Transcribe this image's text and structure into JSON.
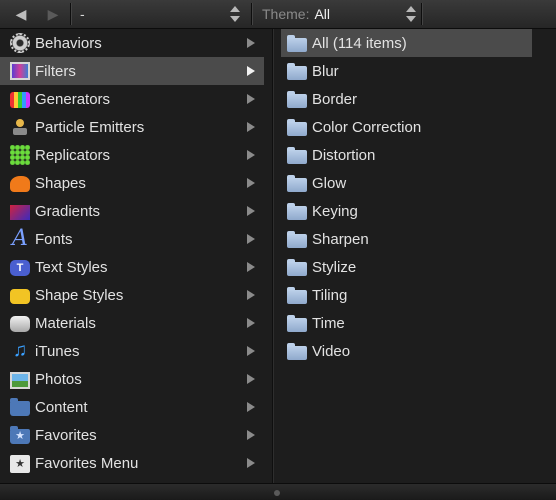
{
  "toolbar": {
    "back_icon": "back-arrow-icon",
    "forward_icon": "forward-arrow-icon",
    "path_value": "-",
    "theme_label": "Theme:",
    "theme_value": "All"
  },
  "categories": [
    {
      "label": "Behaviors",
      "icon": "gear-icon"
    },
    {
      "label": "Filters",
      "icon": "filters-icon",
      "selected": true
    },
    {
      "label": "Generators",
      "icon": "generators-icon"
    },
    {
      "label": "Particle Emitters",
      "icon": "particle-emitters-icon"
    },
    {
      "label": "Replicators",
      "icon": "replicators-icon"
    },
    {
      "label": "Shapes",
      "icon": "shapes-icon"
    },
    {
      "label": "Gradients",
      "icon": "gradients-icon"
    },
    {
      "label": "Fonts",
      "icon": "fonts-icon"
    },
    {
      "label": "Text Styles",
      "icon": "text-styles-icon"
    },
    {
      "label": "Shape Styles",
      "icon": "shape-styles-icon"
    },
    {
      "label": "Materials",
      "icon": "materials-icon"
    },
    {
      "label": "iTunes",
      "icon": "music-note-icon"
    },
    {
      "label": "Photos",
      "icon": "photos-icon"
    },
    {
      "label": "Content",
      "icon": "folder-icon"
    },
    {
      "label": "Favorites",
      "icon": "favorites-folder-icon"
    },
    {
      "label": "Favorites Menu",
      "icon": "favorites-menu-icon"
    }
  ],
  "subcategories": [
    {
      "label": "All (114 items)",
      "selected": true
    },
    {
      "label": "Blur"
    },
    {
      "label": "Border"
    },
    {
      "label": "Color Correction"
    },
    {
      "label": "Distortion"
    },
    {
      "label": "Glow"
    },
    {
      "label": "Keying"
    },
    {
      "label": "Sharpen"
    },
    {
      "label": "Stylize"
    },
    {
      "label": "Tiling"
    },
    {
      "label": "Time"
    },
    {
      "label": "Video"
    }
  ],
  "colors": {
    "background": "#1d1d1d",
    "selection": "#4b4b4b",
    "folder": "#a9bfdd"
  }
}
